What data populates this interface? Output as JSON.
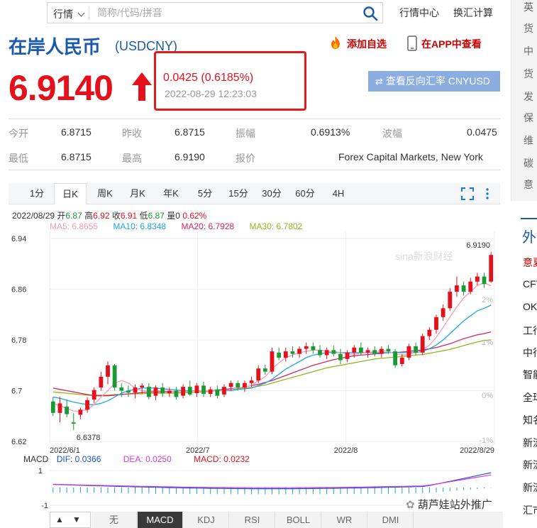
{
  "topbar": {
    "search_type": "行情",
    "search_placeholder": "简称/代码/拼音",
    "links": [
      "行情中心",
      "换汇计算"
    ]
  },
  "title": {
    "name": "在岸人民币",
    "code": "(USDCNY)"
  },
  "actions": {
    "add_fav": "添加自选",
    "app_view": "在APP中查看"
  },
  "quote": {
    "price": "6.9140",
    "change": "0.0425 (0.6185%)",
    "time": "2022-08-29 12:23:03",
    "reverse_btn": "查看反向汇率 CNYUSD"
  },
  "stats": [
    {
      "label": "今开",
      "value": "6.8715"
    },
    {
      "label": "昨收",
      "value": "6.8715"
    },
    {
      "label": "振幅",
      "value": "0.6913%"
    },
    {
      "label": "波幅",
      "value": "0.0475"
    },
    {
      "label": "最低",
      "value": "6.8715"
    },
    {
      "label": "最高",
      "value": "6.9190"
    },
    {
      "label": "报价",
      "value": "Forex Capital Markets, New York"
    }
  ],
  "chart_tabs": [
    "1分",
    "日K",
    "周K",
    "月K",
    "年K",
    "5分",
    "15分",
    "30分",
    "60分",
    "4H"
  ],
  "chart_info": {
    "date": "2022/08/29",
    "open_label": "开",
    "open": "6.87",
    "high_label": "高",
    "high": "6.92",
    "close_label": "收",
    "close": "6.91",
    "low_label": "低",
    "low": "6.87",
    "volume_label": "量",
    "volume": "0",
    "pct": "0.62%"
  },
  "ma_legend": [
    {
      "label": "MA5: 6.8655",
      "color": "#f59bb6"
    },
    {
      "label": "MA10: 6.8348",
      "color": "#1aa7e0"
    },
    {
      "label": "MA20: 6.7928",
      "color": "#d8245e"
    },
    {
      "label": "MA30: 6.7802",
      "color": "#97b51c"
    }
  ],
  "watermark": "sina新浪财经",
  "chart_data": {
    "type": "candlestick",
    "y_ticks": [
      "6.94",
      "6.86",
      "6.78",
      "6.7",
      "6.62"
    ],
    "ylim": [
      6.62,
      6.94
    ],
    "right_ticks": [
      "2%",
      "1%",
      "0%",
      "-1%"
    ],
    "x_ticks": [
      "2022/6/1",
      "2022/7",
      "2022/8",
      "2022/8/29"
    ],
    "high_label": "6.9190",
    "low_label": "6.6378",
    "ohlc": [
      [
        6.683,
        6.69,
        6.66,
        6.665
      ],
      [
        6.665,
        6.69,
        6.65,
        6.68
      ],
      [
        6.675,
        6.685,
        6.658,
        6.663
      ],
      [
        6.65,
        6.665,
        6.638,
        6.648
      ],
      [
        6.662,
        6.673,
        6.655,
        6.67
      ],
      [
        6.67,
        6.69,
        6.665,
        6.685
      ],
      [
        6.686,
        6.705,
        6.68,
        6.701
      ],
      [
        6.705,
        6.73,
        6.7,
        6.722
      ],
      [
        6.722,
        6.746,
        6.71,
        6.74
      ],
      [
        6.74,
        6.742,
        6.7,
        6.705
      ],
      [
        6.705,
        6.712,
        6.69,
        6.7
      ],
      [
        6.7,
        6.708,
        6.69,
        6.697
      ],
      [
        6.697,
        6.71,
        6.688,
        6.705
      ],
      [
        6.705,
        6.712,
        6.695,
        6.708
      ],
      [
        6.706,
        6.712,
        6.686,
        6.69
      ],
      [
        6.692,
        6.708,
        6.685,
        6.705
      ],
      [
        6.705,
        6.712,
        6.69,
        6.696
      ],
      [
        6.696,
        6.705,
        6.69,
        6.7
      ],
      [
        6.7,
        6.706,
        6.686,
        6.69
      ],
      [
        6.692,
        6.71,
        6.688,
        6.706
      ],
      [
        6.706,
        6.716,
        6.692,
        6.694
      ],
      [
        6.696,
        6.712,
        6.69,
        6.708
      ],
      [
        6.708,
        6.714,
        6.69,
        6.695
      ],
      [
        6.695,
        6.706,
        6.69,
        6.702
      ],
      [
        6.702,
        6.708,
        6.688,
        6.692
      ],
      [
        6.694,
        6.71,
        6.69,
        6.706
      ],
      [
        6.706,
        6.716,
        6.7,
        6.712
      ],
      [
        6.712,
        6.716,
        6.7,
        6.705
      ],
      [
        6.705,
        6.716,
        6.698,
        6.712
      ],
      [
        6.712,
        6.722,
        6.706,
        6.716
      ],
      [
        6.716,
        6.74,
        6.712,
        6.735
      ],
      [
        6.735,
        6.741,
        6.725,
        6.73
      ],
      [
        6.73,
        6.768,
        6.726,
        6.762
      ],
      [
        6.76,
        6.768,
        6.748,
        6.752
      ],
      [
        6.752,
        6.768,
        6.746,
        6.762
      ],
      [
        6.762,
        6.77,
        6.752,
        6.758
      ],
      [
        6.758,
        6.77,
        6.752,
        6.766
      ],
      [
        6.766,
        6.776,
        6.758,
        6.77
      ],
      [
        6.77,
        6.776,
        6.758,
        6.764
      ],
      [
        6.764,
        6.772,
        6.752,
        6.756
      ],
      [
        6.756,
        6.768,
        6.75,
        6.764
      ],
      [
        6.764,
        6.771,
        6.754,
        6.758
      ],
      [
        6.758,
        6.766,
        6.742,
        6.748
      ],
      [
        6.75,
        6.764,
        6.745,
        6.76
      ],
      [
        6.76,
        6.772,
        6.752,
        6.768
      ],
      [
        6.768,
        6.776,
        6.756,
        6.76
      ],
      [
        6.76,
        6.768,
        6.752,
        6.764
      ],
      [
        6.764,
        6.77,
        6.754,
        6.758
      ],
      [
        6.758,
        6.77,
        6.752,
        6.766
      ],
      [
        6.766,
        6.772,
        6.758,
        6.762
      ],
      [
        6.762,
        6.766,
        6.736,
        6.74
      ],
      [
        6.742,
        6.758,
        6.738,
        6.752
      ],
      [
        6.752,
        6.774,
        6.748,
        6.77
      ],
      [
        6.77,
        6.776,
        6.756,
        6.76
      ],
      [
        6.76,
        6.79,
        6.756,
        6.786
      ],
      [
        6.786,
        6.8,
        6.78,
        6.796
      ],
      [
        6.796,
        6.82,
        6.79,
        6.816
      ],
      [
        6.816,
        6.836,
        6.81,
        6.83
      ],
      [
        6.83,
        6.862,
        6.826,
        6.856
      ],
      [
        6.856,
        6.88,
        6.848,
        6.866
      ],
      [
        6.866,
        6.872,
        6.85,
        6.856
      ],
      [
        6.856,
        6.878,
        6.852,
        6.872
      ],
      [
        6.872,
        6.886,
        6.866,
        6.88
      ],
      [
        6.88,
        6.886,
        6.862,
        6.868
      ],
      [
        6.872,
        6.919,
        6.87,
        6.914
      ]
    ],
    "ma5": [
      6.68,
      6.676,
      6.672,
      6.668,
      6.668,
      6.67,
      6.678,
      6.69,
      6.7,
      6.712,
      6.716,
      6.712,
      6.704,
      6.7,
      6.7,
      6.7,
      6.7,
      6.699,
      6.698,
      6.698,
      6.699,
      6.7,
      6.7,
      6.7,
      6.7,
      6.7,
      6.702,
      6.704,
      6.706,
      6.708,
      6.716,
      6.722,
      6.734,
      6.744,
      6.752,
      6.756,
      6.76,
      6.762,
      6.764,
      6.764,
      6.762,
      6.762,
      6.76,
      6.758,
      6.758,
      6.759,
      6.76,
      6.762,
      6.763,
      6.762,
      6.758,
      6.756,
      6.758,
      6.76,
      6.764,
      6.772,
      6.784,
      6.8,
      6.816,
      6.832,
      6.846,
      6.856,
      6.866,
      6.87,
      6.8655
    ],
    "ma10": [
      6.69,
      6.688,
      6.685,
      6.682,
      6.68,
      6.678,
      6.678,
      6.68,
      6.684,
      6.69,
      6.696,
      6.7,
      6.702,
      6.704,
      6.704,
      6.704,
      6.703,
      6.702,
      6.701,
      6.7,
      6.7,
      6.7,
      6.7,
      6.7,
      6.7,
      6.7,
      6.7,
      6.702,
      6.703,
      6.704,
      6.708,
      6.712,
      6.718,
      6.726,
      6.734,
      6.74,
      6.746,
      6.752,
      6.756,
      6.758,
      6.76,
      6.76,
      6.76,
      6.76,
      6.76,
      6.76,
      6.76,
      6.76,
      6.76,
      6.76,
      6.76,
      6.76,
      6.76,
      6.76,
      6.762,
      6.766,
      6.772,
      6.78,
      6.79,
      6.8,
      6.81,
      6.818,
      6.826,
      6.83,
      6.8348
    ],
    "ma20": [
      6.704,
      6.702,
      6.7,
      6.698,
      6.696,
      6.694,
      6.692,
      6.692,
      6.692,
      6.693,
      6.694,
      6.695,
      6.696,
      6.697,
      6.698,
      6.698,
      6.698,
      6.698,
      6.698,
      6.698,
      6.699,
      6.7,
      6.7,
      6.7,
      6.701,
      6.702,
      6.703,
      6.704,
      6.706,
      6.708,
      6.71,
      6.713,
      6.716,
      6.72,
      6.724,
      6.728,
      6.732,
      6.736,
      6.74,
      6.743,
      6.746,
      6.749,
      6.751,
      6.753,
      6.755,
      6.756,
      6.757,
      6.758,
      6.759,
      6.76,
      6.76,
      6.761,
      6.762,
      6.763,
      6.764,
      6.766,
      6.768,
      6.771,
      6.774,
      6.778,
      6.782,
      6.785,
      6.788,
      6.79,
      6.7928
    ],
    "ma30": [
      6.698,
      6.697,
      6.696,
      6.695,
      6.694,
      6.693,
      6.693,
      6.693,
      6.693,
      6.694,
      6.694,
      6.695,
      6.695,
      6.695,
      6.696,
      6.696,
      6.696,
      6.696,
      6.696,
      6.697,
      6.697,
      6.698,
      6.698,
      6.699,
      6.7,
      6.701,
      6.702,
      6.703,
      6.704,
      6.705,
      6.707,
      6.709,
      6.712,
      6.715,
      6.718,
      6.721,
      6.724,
      6.727,
      6.73,
      6.733,
      6.736,
      6.738,
      6.74,
      6.742,
      6.744,
      6.746,
      6.748,
      6.75,
      6.751,
      6.752,
      6.753,
      6.754,
      6.755,
      6.756,
      6.757,
      6.759,
      6.761,
      6.763,
      6.765,
      6.768,
      6.771,
      6.774,
      6.777,
      6.779,
      6.7802
    ]
  },
  "macd": {
    "label": "MACD",
    "dif": "DIF: 0.0366",
    "dea": "DEA: 0.0250",
    "macd_val": "MACD: 0.0232",
    "y_ticks": [
      "1",
      "-1"
    ],
    "x_ticks": [
      "2022/6/1",
      "2022/7",
      "2022/8",
      "2022/8/29"
    ]
  },
  "bottom_tabs": [
    "无",
    "MACD",
    "KDJ",
    "RSI",
    "BOLL",
    "WR",
    "DMI"
  ],
  "right_panel": {
    "title": "外",
    "items_top": [
      "英",
      "货",
      "中",
      "货",
      "发",
      "保",
      "维",
      "碳",
      "意"
    ],
    "items": [
      "意夏",
      "CFT",
      "OKx",
      "工行",
      "中行",
      "智能",
      "全球",
      "知名",
      "新流",
      "新流",
      "新流",
      "汇市"
    ]
  },
  "footer_watermark": "葫芦娃站外推广"
}
